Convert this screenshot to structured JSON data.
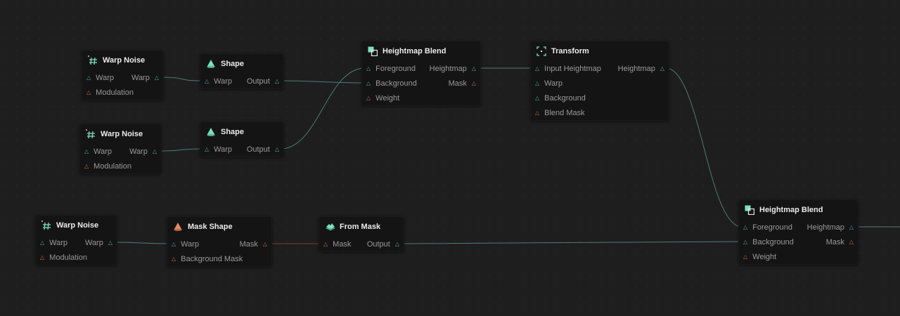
{
  "graph": {
    "nodes": [
      {
        "id": "wn1",
        "title": "Warp Noise",
        "icon": "warp-noise-icon",
        "inputs": [
          {
            "label": "Warp",
            "color": "teal"
          },
          {
            "label": "Modulation",
            "color": "orange"
          }
        ],
        "outputs": [
          {
            "label": "Warp",
            "color": "teal"
          }
        ]
      },
      {
        "id": "sh1",
        "title": "Shape",
        "icon": "shape-icon",
        "inputs": [
          {
            "label": "Warp",
            "color": "teal"
          }
        ],
        "outputs": [
          {
            "label": "Output",
            "color": "teal"
          }
        ]
      },
      {
        "id": "wn2",
        "title": "Warp Noise",
        "icon": "warp-noise-icon",
        "inputs": [
          {
            "label": "Warp",
            "color": "teal"
          },
          {
            "label": "Modulation",
            "color": "orange"
          }
        ],
        "outputs": [
          {
            "label": "Warp",
            "color": "teal"
          }
        ]
      },
      {
        "id": "sh2",
        "title": "Shape",
        "icon": "shape-icon",
        "inputs": [
          {
            "label": "Warp",
            "color": "teal"
          }
        ],
        "outputs": [
          {
            "label": "Output",
            "color": "teal"
          }
        ]
      },
      {
        "id": "hb1",
        "title": "Heightmap Blend",
        "icon": "heightmap-blend-icon",
        "inputs": [
          {
            "label": "Foreground",
            "color": "teal"
          },
          {
            "label": "Background",
            "color": "teal"
          },
          {
            "label": "Weight",
            "color": "orange"
          }
        ],
        "outputs": [
          {
            "label": "Heightmap",
            "color": "teal"
          },
          {
            "label": "Mask",
            "color": "orange"
          }
        ]
      },
      {
        "id": "tf1",
        "title": "Transform",
        "icon": "transform-icon",
        "inputs": [
          {
            "label": "Input Heightmap",
            "color": "teal"
          },
          {
            "label": "Warp",
            "color": "teal"
          },
          {
            "label": "Background",
            "color": "teal"
          },
          {
            "label": "Blend Mask",
            "color": "orange"
          }
        ],
        "outputs": [
          {
            "label": "Heightmap",
            "color": "teal"
          }
        ]
      },
      {
        "id": "wn3",
        "title": "Warp Noise",
        "icon": "warp-noise-icon",
        "inputs": [
          {
            "label": "Warp",
            "color": "teal"
          },
          {
            "label": "Modulation",
            "color": "orange"
          }
        ],
        "outputs": [
          {
            "label": "Warp",
            "color": "teal"
          }
        ]
      },
      {
        "id": "ms1",
        "title": "Mask Shape",
        "icon": "mask-shape-icon",
        "inputs": [
          {
            "label": "Warp",
            "color": "teal"
          },
          {
            "label": "Background Mask",
            "color": "orange"
          }
        ],
        "outputs": [
          {
            "label": "Mask",
            "color": "orange"
          }
        ]
      },
      {
        "id": "fm1",
        "title": "From Mask",
        "icon": "from-mask-icon",
        "inputs": [
          {
            "label": "Mask",
            "color": "orange"
          }
        ],
        "outputs": [
          {
            "label": "Output",
            "color": "teal"
          }
        ]
      },
      {
        "id": "hb2",
        "title": "Heightmap Blend",
        "icon": "heightmap-blend-icon",
        "inputs": [
          {
            "label": "Foreground",
            "color": "teal"
          },
          {
            "label": "Background",
            "color": "teal"
          },
          {
            "label": "Weight",
            "color": "orange"
          }
        ],
        "outputs": [
          {
            "label": "Heightmap",
            "color": "teal"
          },
          {
            "label": "Mask",
            "color": "orange"
          }
        ]
      }
    ],
    "edges": [
      {
        "from": "wn1",
        "from_port": 0,
        "to": "sh1",
        "to_port": 0,
        "color": "teal"
      },
      {
        "from": "sh1",
        "from_port": 0,
        "to": "hb1",
        "to_port": 1,
        "color": "teal"
      },
      {
        "from": "wn2",
        "from_port": 0,
        "to": "sh2",
        "to_port": 0,
        "color": "teal"
      },
      {
        "from": "sh2",
        "from_port": 0,
        "to": "hb1",
        "to_port": 0,
        "color": "teal"
      },
      {
        "from": "hb1",
        "from_port": 0,
        "to": "tf1",
        "to_port": 0,
        "color": "teal"
      },
      {
        "from": "tf1",
        "from_port": 0,
        "to": "hb2",
        "to_port": 0,
        "color": "teal"
      },
      {
        "from": "wn3",
        "from_port": 0,
        "to": "ms1",
        "to_port": 0,
        "color": "teal"
      },
      {
        "from": "ms1",
        "from_port": 0,
        "to": "fm1",
        "to_port": 0,
        "color": "orange"
      },
      {
        "from": "fm1",
        "from_port": 0,
        "to": "hb2",
        "to_port": 1,
        "color": "teal"
      },
      {
        "from": "hb2",
        "from_port": 0,
        "to": null,
        "to_port": null,
        "color": "teal"
      }
    ]
  },
  "colors": {
    "canvas": "#1e1e1e",
    "node": "#141414",
    "port_teal": "#4fa896",
    "port_orange": "#c46a4c",
    "wire_teal": "#4f7d74",
    "wire_orange": "#7d3f2e",
    "icon_green": "#7fe0bd",
    "icon_orange": "#e88865"
  }
}
